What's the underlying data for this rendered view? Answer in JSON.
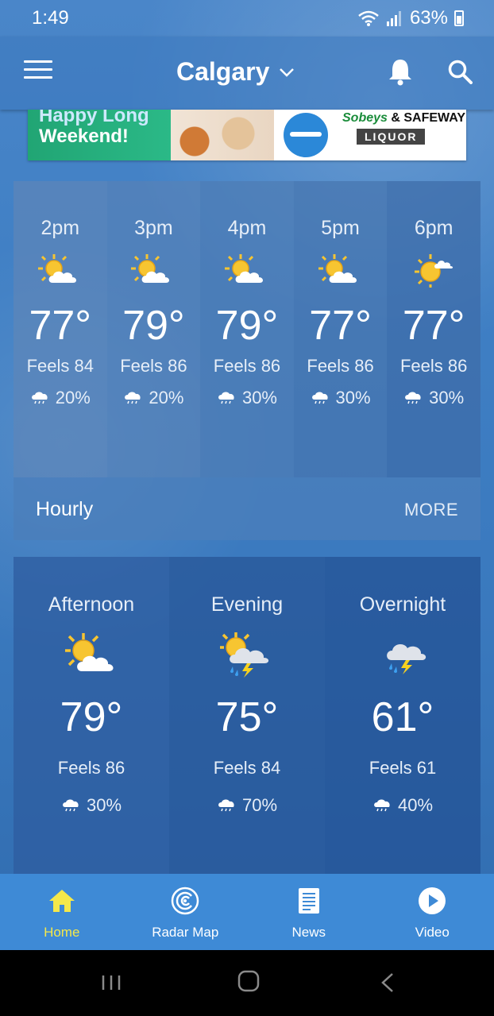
{
  "status_bar": {
    "time": "1:49",
    "battery": "63%"
  },
  "app_bar": {
    "city": "Calgary"
  },
  "ad": {
    "line1": "Happy Long",
    "line2": "Weekend!",
    "brand": "Sobeys",
    "brand2": "& SAFEWAY",
    "liquor": "LIQUOR"
  },
  "hourly": {
    "label": "Hourly",
    "more": "MORE",
    "items": [
      {
        "time": "2pm",
        "temp": "77°",
        "feels": "Feels 84",
        "precip": "20%",
        "icon": "partly-sunny-icon"
      },
      {
        "time": "3pm",
        "temp": "79°",
        "feels": "Feels 86",
        "precip": "20%",
        "icon": "partly-sunny-icon"
      },
      {
        "time": "4pm",
        "temp": "79°",
        "feels": "Feels 86",
        "precip": "30%",
        "icon": "partly-sunny-icon"
      },
      {
        "time": "5pm",
        "temp": "77°",
        "feels": "Feels 86",
        "precip": "30%",
        "icon": "partly-sunny-icon"
      },
      {
        "time": "6pm",
        "temp": "77°",
        "feels": "Feels 86",
        "precip": "30%",
        "icon": "mostly-sunny-icon"
      }
    ]
  },
  "dayparts": [
    {
      "name": "Afternoon",
      "temp": "79°",
      "feels": "Feels 86",
      "precip": "30%",
      "icon": "partly-sunny-icon"
    },
    {
      "name": "Evening",
      "temp": "75°",
      "feels": "Feels 84",
      "precip": "70%",
      "icon": "thunderstorm-sun-icon"
    },
    {
      "name": "Overnight",
      "temp": "61°",
      "feels": "Feels 61",
      "precip": "40%",
      "icon": "thunderstorm-icon"
    }
  ],
  "bottom_nav": [
    {
      "label": "Home",
      "icon": "home-icon",
      "active": true
    },
    {
      "label": "Radar Map",
      "icon": "radar-icon",
      "active": false
    },
    {
      "label": "News",
      "icon": "news-icon",
      "active": false
    },
    {
      "label": "Video",
      "icon": "play-icon",
      "active": false
    }
  ],
  "colors": {
    "accent_active": "#f4e84a",
    "nav_background": "#3e8ad6",
    "sun": "#f7c531"
  }
}
